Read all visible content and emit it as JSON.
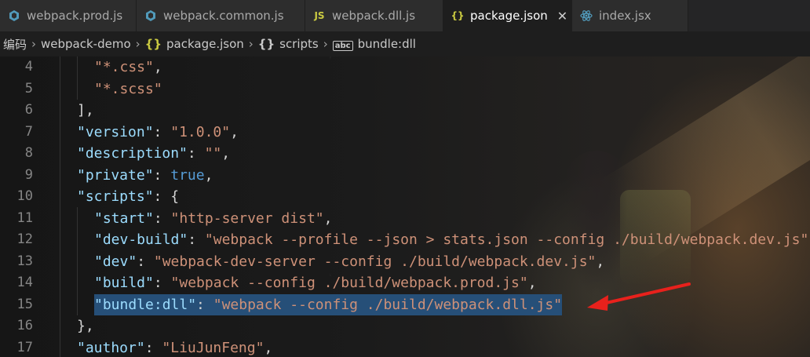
{
  "tabs": [
    {
      "label": "webpack.prod.js",
      "icon": "gear-icon",
      "active": false
    },
    {
      "label": "webpack.common.js",
      "icon": "gear-icon",
      "active": false
    },
    {
      "label": "webpack.dll.js",
      "icon": "js-file-icon",
      "icon_text": "JS",
      "active": false
    },
    {
      "label": "package.json",
      "icon": "json-file-icon",
      "icon_text": "{}",
      "active": true,
      "close_glyph": "✕"
    },
    {
      "label": "index.jsx",
      "icon": "react-file-icon",
      "active": false
    }
  ],
  "breadcrumb": {
    "items": [
      "编码",
      "webpack-demo",
      "package.json",
      "scripts",
      "bundle:dll"
    ],
    "icons": [
      "",
      "",
      "{}",
      "{}",
      "abc"
    ],
    "separator": "›"
  },
  "editor": {
    "lines": [
      {
        "number": "4",
        "tokens": [
          {
            "t": "\"*.css\"",
            "c": "s"
          },
          {
            "t": ",",
            "c": "p"
          }
        ],
        "indent": 2
      },
      {
        "number": "5",
        "tokens": [
          {
            "t": "\"*.scss\"",
            "c": "s"
          }
        ],
        "indent": 2
      },
      {
        "number": "6",
        "tokens": [
          {
            "t": "],",
            "c": "p"
          }
        ],
        "indent": 1
      },
      {
        "number": "7",
        "tokens": [
          {
            "t": "\"version\"",
            "c": "k"
          },
          {
            "t": ": ",
            "c": "p"
          },
          {
            "t": "\"1.0.0\"",
            "c": "s"
          },
          {
            "t": ",",
            "c": "p"
          }
        ],
        "indent": 1
      },
      {
        "number": "8",
        "tokens": [
          {
            "t": "\"description\"",
            "c": "k"
          },
          {
            "t": ": ",
            "c": "p"
          },
          {
            "t": "\"\"",
            "c": "s"
          },
          {
            "t": ",",
            "c": "p"
          }
        ],
        "indent": 1
      },
      {
        "number": "9",
        "tokens": [
          {
            "t": "\"private\"",
            "c": "k"
          },
          {
            "t": ": ",
            "c": "p"
          },
          {
            "t": "true",
            "c": "b"
          },
          {
            "t": ",",
            "c": "p"
          }
        ],
        "indent": 1
      },
      {
        "number": "10",
        "tokens": [
          {
            "t": "\"scripts\"",
            "c": "k"
          },
          {
            "t": ": {",
            "c": "p"
          }
        ],
        "indent": 1
      },
      {
        "number": "11",
        "tokens": [
          {
            "t": "\"start\"",
            "c": "k"
          },
          {
            "t": ": ",
            "c": "p"
          },
          {
            "t": "\"http-server dist\"",
            "c": "s"
          },
          {
            "t": ",",
            "c": "p"
          }
        ],
        "indent": 2
      },
      {
        "number": "12",
        "tokens": [
          {
            "t": "\"dev-build\"",
            "c": "k"
          },
          {
            "t": ": ",
            "c": "p"
          },
          {
            "t": "\"webpack --profile --json > stats.json --config ./build/webpack.dev.js\"",
            "c": "s"
          }
        ],
        "indent": 2
      },
      {
        "number": "13",
        "tokens": [
          {
            "t": "\"dev\"",
            "c": "k"
          },
          {
            "t": ": ",
            "c": "p"
          },
          {
            "t": "\"webpack-dev-server --config ./build/webpack.dev.js\"",
            "c": "s"
          },
          {
            "t": ",",
            "c": "p"
          }
        ],
        "indent": 2
      },
      {
        "number": "14",
        "tokens": [
          {
            "t": "\"build\"",
            "c": "k"
          },
          {
            "t": ": ",
            "c": "p"
          },
          {
            "t": "\"webpack --config ./build/webpack.prod.js\"",
            "c": "s"
          },
          {
            "t": ",",
            "c": "p"
          }
        ],
        "indent": 2
      },
      {
        "number": "15",
        "tokens": [
          {
            "t": "\"bundle:dll\"",
            "c": "k"
          },
          {
            "t": ": ",
            "c": "p"
          },
          {
            "t": "\"webpack --config ./build/webpack.dll.js\"",
            "c": "s"
          }
        ],
        "indent": 2,
        "selected": true
      },
      {
        "number": "16",
        "tokens": [
          {
            "t": "},",
            "c": "p"
          }
        ],
        "indent": 1
      },
      {
        "number": "17",
        "tokens": [
          {
            "t": "\"author\"",
            "c": "k"
          },
          {
            "t": ": ",
            "c": "p"
          },
          {
            "t": "\"LiuJunFeng\"",
            "c": "s"
          },
          {
            "t": ",",
            "c": "p"
          }
        ],
        "indent": 1
      }
    ],
    "selection_color": "#264f78",
    "annotation_arrow_color": "#e8211c"
  },
  "colors": {
    "key": "#9cdcfe",
    "string": "#ce9178",
    "boolean": "#569cd6",
    "punctuation": "#d4d4d4",
    "line_number": "#858585"
  }
}
